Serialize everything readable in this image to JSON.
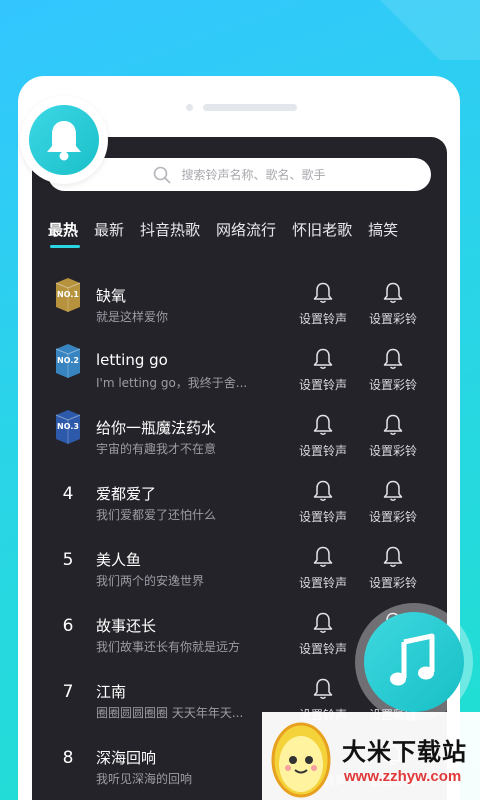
{
  "search": {
    "placeholder": "搜索铃声名称、歌名、歌手"
  },
  "tabs": [
    {
      "label": "最热",
      "active": true
    },
    {
      "label": "最新"
    },
    {
      "label": "抖音热歌"
    },
    {
      "label": "网络流行"
    },
    {
      "label": "怀旧老歌"
    },
    {
      "label": "搞笑"
    }
  ],
  "actions": {
    "ring_label": "设置铃声",
    "color_label": "设置彩铃"
  },
  "songs": [
    {
      "rank": "NO.1",
      "title": "缺氧",
      "subtitle": "就是这样爱你",
      "badge_color": "#c8a040"
    },
    {
      "rank": "NO.2",
      "title": "letting go",
      "subtitle": "I'm letting go，我终于舍...",
      "badge_color": "#3a8fd0"
    },
    {
      "rank": "NO.3",
      "title": "给你一瓶魔法药水",
      "subtitle": "宇宙的有趣我才不在意",
      "badge_color": "#2e5fb8"
    },
    {
      "rank": "4",
      "title": "爱都爱了",
      "subtitle": "我们爱都爱了还怕什么"
    },
    {
      "rank": "5",
      "title": "美人鱼",
      "subtitle": "我们两个的安逸世界"
    },
    {
      "rank": "6",
      "title": "故事还长",
      "subtitle": "我们故事还长有你就是远方"
    },
    {
      "rank": "7",
      "title": "江南",
      "subtitle": "圈圈圆圆圈圈 天天年年天..."
    },
    {
      "rank": "8",
      "title": "深海回响",
      "subtitle": "我听见深海的回响"
    }
  ],
  "watermark": {
    "name": "大米下载站",
    "url": "www.zzhyw.com"
  },
  "colors": {
    "accent": "#2ad4e0",
    "screen_bg": "#24232a"
  }
}
